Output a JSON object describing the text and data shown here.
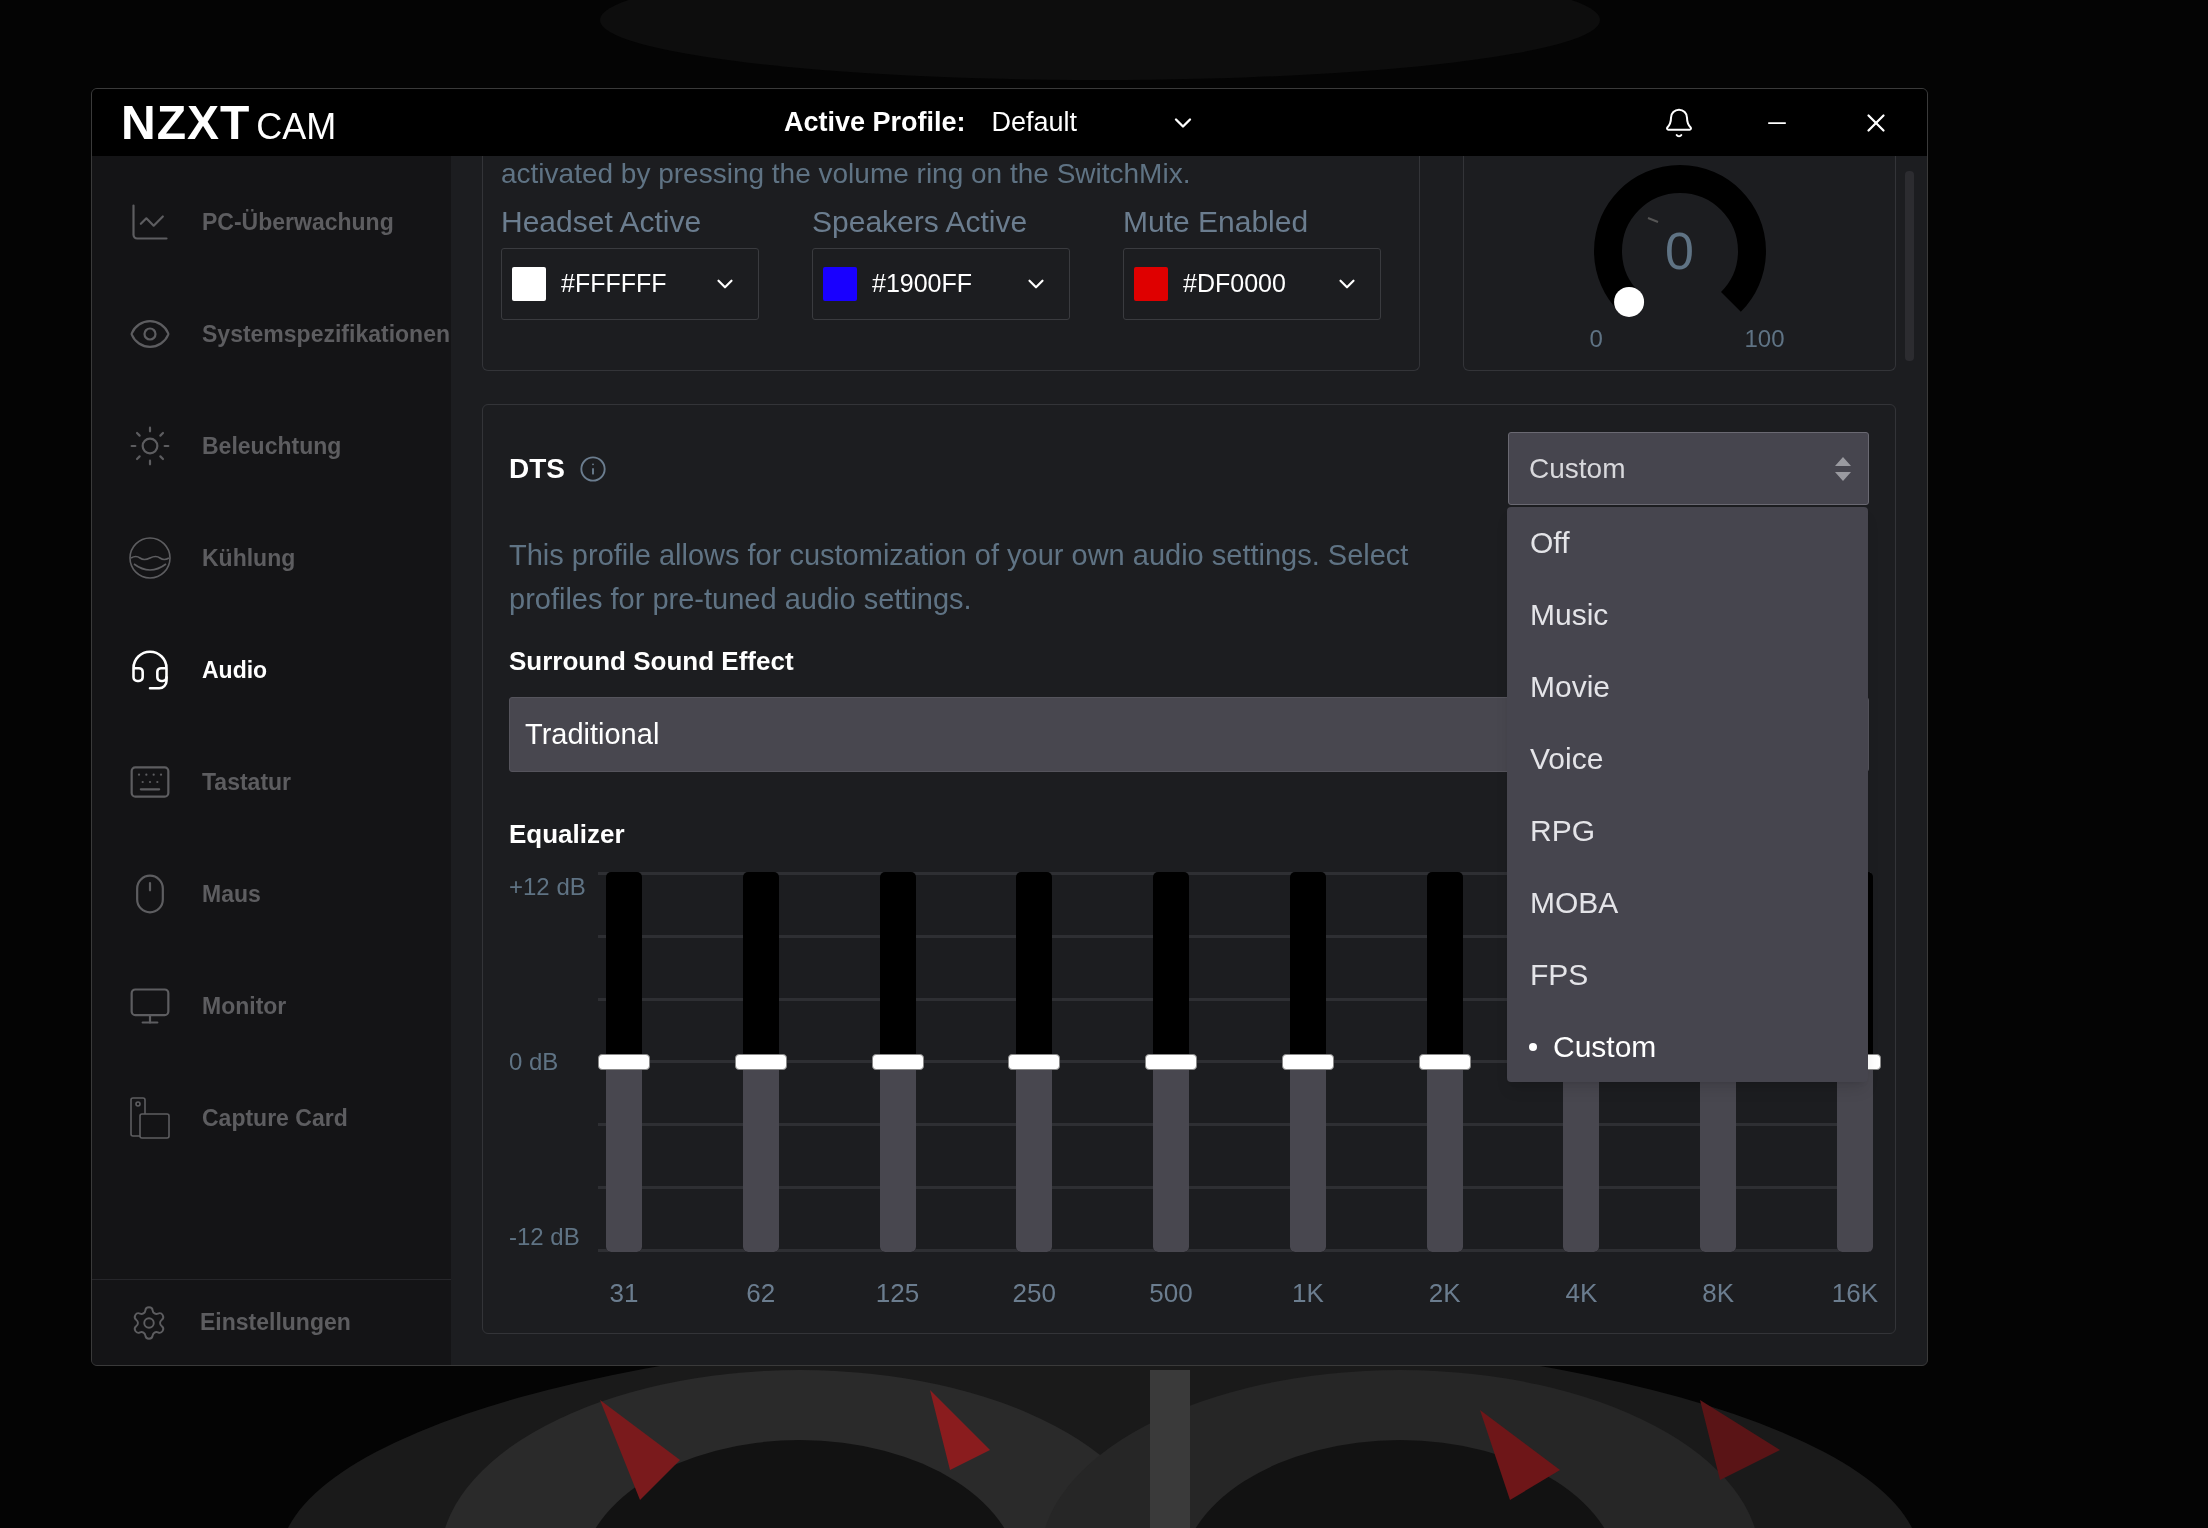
{
  "window": {
    "logo_bold": "NZXT",
    "logo_light": "CAM",
    "profile_label": "Active Profile:",
    "profile_value": "Default"
  },
  "sidebar": {
    "items": [
      {
        "label": "PC-Überwachung",
        "selected": false
      },
      {
        "label": "Systemspezifikationen",
        "selected": false
      },
      {
        "label": "Beleuchtung",
        "selected": false
      },
      {
        "label": "Kühlung",
        "selected": false
      },
      {
        "label": "Audio",
        "selected": true
      },
      {
        "label": "Tastatur",
        "selected": false
      },
      {
        "label": "Maus",
        "selected": false
      },
      {
        "label": "Monitor",
        "selected": false
      },
      {
        "label": "Capture Card",
        "selected": false
      }
    ],
    "footer": {
      "label": "Einstellungen"
    }
  },
  "lighting_card": {
    "note": "activated by pressing the volume ring on the SwitchMix.",
    "colors": [
      {
        "label": "Headset Active",
        "value": "#FFFFFF",
        "color": "#ffffff"
      },
      {
        "label": "Speakers Active",
        "value": "#1900FF",
        "color": "#1900ff"
      },
      {
        "label": "Mute Enabled",
        "value": "#DF0000",
        "color": "#df0000"
      }
    ]
  },
  "volume_gauge": {
    "value": "0",
    "min_label": "0",
    "max_label": "100",
    "level": 0
  },
  "dts": {
    "title": "DTS",
    "profile_select": {
      "value": "Custom",
      "expanded": true,
      "options": [
        {
          "label": "Off",
          "selected": false
        },
        {
          "label": "Music",
          "selected": false
        },
        {
          "label": "Movie",
          "selected": false
        },
        {
          "label": "Voice",
          "selected": false
        },
        {
          "label": "RPG",
          "selected": false
        },
        {
          "label": "MOBA",
          "selected": false
        },
        {
          "label": "FPS",
          "selected": false
        },
        {
          "label": "Custom",
          "selected": true
        }
      ]
    },
    "description": "This profile allows for customization of your own audio settings. Select profiles for pre-tuned audio settings.",
    "surround_label": "Surround Sound Effect",
    "surround_value": "Traditional",
    "equalizer": {
      "title": "Equalizer",
      "scale": [
        "+12 dB",
        "0 dB",
        "-12 dB"
      ],
      "bands": [
        {
          "label": "31",
          "level": 0.5
        },
        {
          "label": "62",
          "level": 0.5
        },
        {
          "label": "125",
          "level": 0.5
        },
        {
          "label": "250",
          "level": 0.5
        },
        {
          "label": "500",
          "level": 0.5
        },
        {
          "label": "1K",
          "level": 0.5
        },
        {
          "label": "2K",
          "level": 0.5
        },
        {
          "label": "4K",
          "level": 0.5
        },
        {
          "label": "8K",
          "level": 0.5
        },
        {
          "label": "16K",
          "level": 0.5
        }
      ]
    }
  }
}
